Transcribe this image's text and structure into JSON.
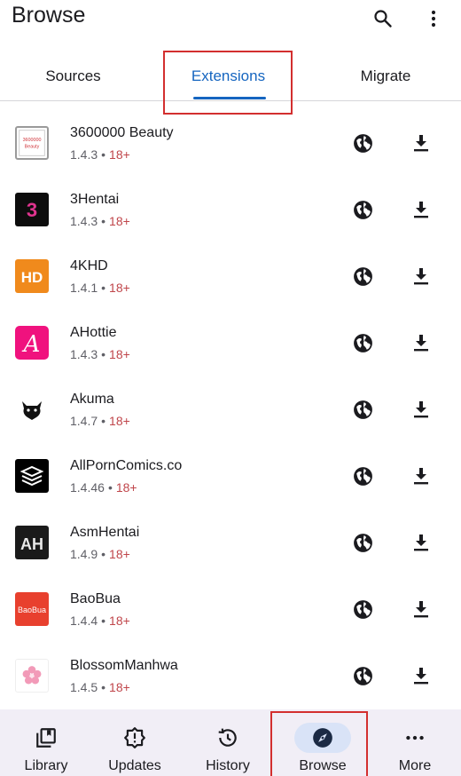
{
  "appbar": {
    "title": "Browse",
    "search_icon": "search-icon",
    "overflow_icon": "more-vert-icon"
  },
  "tabs": [
    {
      "label": "Sources",
      "selected": false
    },
    {
      "label": "Extensions",
      "selected": true
    },
    {
      "label": "Migrate",
      "selected": false
    }
  ],
  "colors": {
    "accent": "#1565c0",
    "nsfw": "#c0464b",
    "highlight": "#d32f2f",
    "nav_active_bg": "#d9e3f7"
  },
  "extensions": [
    {
      "name": "3600000 Beauty",
      "version": "1.4.3",
      "separator": "•",
      "tag": "18+",
      "icon_text": "3600000\nBeauty"
    },
    {
      "name": "3Hentai",
      "version": "1.4.3",
      "separator": "•",
      "tag": "18+",
      "icon_text": "3"
    },
    {
      "name": "4KHD",
      "version": "1.4.1",
      "separator": "•",
      "tag": "18+",
      "icon_text": "HD"
    },
    {
      "name": "AHottie",
      "version": "1.4.3",
      "separator": "•",
      "tag": "18+",
      "icon_text": "A"
    },
    {
      "name": "Akuma",
      "version": "1.4.7",
      "separator": "•",
      "tag": "18+",
      "icon_text": ""
    },
    {
      "name": "AllPornComics.co",
      "version": "1.4.46",
      "separator": "•",
      "tag": "18+",
      "icon_text": ""
    },
    {
      "name": "AsmHentai",
      "version": "1.4.9",
      "separator": "•",
      "tag": "18+",
      "icon_text": "AH"
    },
    {
      "name": "BaoBua",
      "version": "1.4.4",
      "separator": "•",
      "tag": "18+",
      "icon_text": "BaoBua"
    },
    {
      "name": "BlossomManhwa",
      "version": "1.4.5",
      "separator": "•",
      "tag": "18+",
      "icon_text": ""
    }
  ],
  "bottom_nav": [
    {
      "label": "Library",
      "icon": "library-icon",
      "active": false
    },
    {
      "label": "Updates",
      "icon": "updates-icon",
      "active": false
    },
    {
      "label": "History",
      "icon": "history-icon",
      "active": false
    },
    {
      "label": "Browse",
      "icon": "browse-icon",
      "active": true
    },
    {
      "label": "More",
      "icon": "more-horiz-icon",
      "active": false
    }
  ]
}
